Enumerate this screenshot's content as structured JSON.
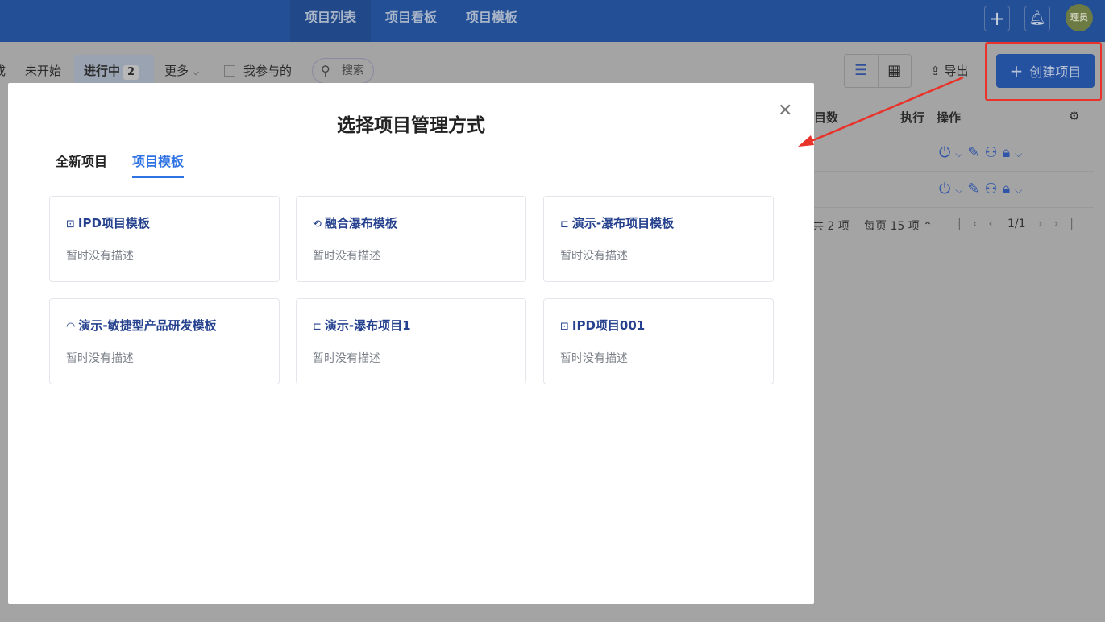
{
  "header": {
    "tabs": [
      {
        "label": "项目列表",
        "active": true
      },
      {
        "label": "项目看板"
      },
      {
        "label": "项目模板"
      }
    ],
    "avatar": "理员"
  },
  "toolbar": {
    "partial_tab": "成",
    "tab_not_started": "未开始",
    "tab_in_progress": "进行中",
    "in_progress_count": "2",
    "more": "更多",
    "mine_checkbox": "我参与的",
    "search_placeholder": "搜索",
    "export": "导出",
    "create": "创建项目"
  },
  "table": {
    "col_count": "目数",
    "col_exec": "执行",
    "col_ops": "操作",
    "pagination": {
      "total": "共 2 项",
      "per_page": "每页 15 项",
      "page": "1/1"
    }
  },
  "modal": {
    "title": "选择项目管理方式",
    "tabs": [
      {
        "label": "全新项目"
      },
      {
        "label": "项目模板",
        "active": true
      }
    ],
    "cards": [
      {
        "icon": "ipd-icon",
        "glyph": "⊡",
        "title": "IPD项目模板",
        "desc": "暂时没有描述"
      },
      {
        "icon": "hybrid-waterfall-icon",
        "glyph": "⟲",
        "title": "融合瀑布模板",
        "desc": "暂时没有描述"
      },
      {
        "icon": "waterfall-icon",
        "glyph": "⊏",
        "title": "演示-瀑布项目模板",
        "desc": "暂时没有描述"
      },
      {
        "icon": "agile-icon",
        "glyph": "◠",
        "title": "演示-敏捷型产品研发模板",
        "desc": "暂时没有描述"
      },
      {
        "icon": "waterfall-icon",
        "glyph": "⊏",
        "title": "演示-瀑布项目1",
        "desc": "暂时没有描述"
      },
      {
        "icon": "ipd-icon",
        "glyph": "⊡",
        "title": "IPD项目001",
        "desc": "暂时没有描述"
      }
    ]
  },
  "colors": {
    "header": "#234f96",
    "accent": "#2f72e4",
    "annotation": "#e8322a"
  }
}
